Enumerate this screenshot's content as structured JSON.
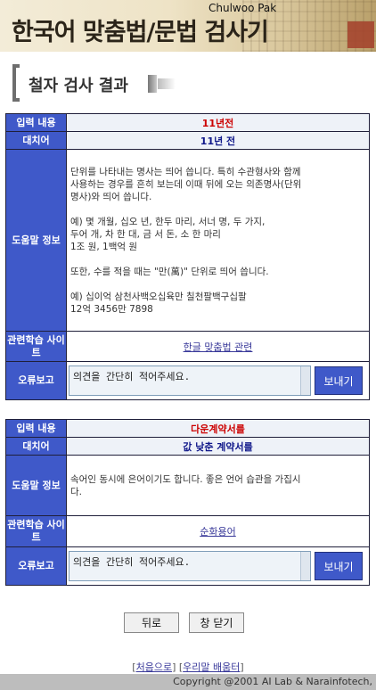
{
  "header": {
    "title": "한국어 맞춤법/문법 검사기",
    "author": "Chulwoo Pak"
  },
  "section_title": "철자 검사 결과",
  "results": [
    {
      "input_label": "입력 내용",
      "input_value": "11년전",
      "suggestion_label": "대치어",
      "suggestion_value": "11년 전",
      "help_label": "도움말 정보",
      "help_text": [
        "단위를 나타내는 명사는 띄어 씁니다. 특히 수관형사와 함께",
        "사용하는 경우를 흔히 보는데 이때 뒤에 오는 의존명사(단위",
        "명사)와 띄어 씁니다.",
        "",
        "예) 몇 개월, 십오 년, 한두 마리, 서너 명, 두 가지,",
        "두어 개, 차 한 대, 금 서 돈, 소 한 마리",
        "1조 원, 1백억 원",
        "",
        "또한, 수를 적을 때는 \"만(萬)\" 단위로 띄어 씁니다.",
        "",
        "예) 십이억 삼천사백오십육만 칠천팔백구십팔",
        "12억 3456만 7898"
      ],
      "related_label": "관련학습 사이트",
      "related_link": "한글 맞춤법 관련",
      "report_label": "오류보고",
      "report_placeholder": "의견을 간단히 적어주세요.",
      "report_button": "보내기"
    },
    {
      "input_label": "입력 내용",
      "input_value": "다운계약서를",
      "suggestion_label": "대치어",
      "suggestion_value": "값 낮춘 계약서를",
      "help_label": "도움말 정보",
      "help_text": [
        "속어인 동시에 은어이기도 합니다. 좋은 언어 습관을 가집시",
        "다."
      ],
      "related_label": "관련학습 사이트",
      "related_link": "순화용어",
      "report_label": "오류보고",
      "report_placeholder": "의견을 간단히 적어주세요.",
      "report_button": "보내기"
    }
  ],
  "buttons": {
    "back": "뒤로",
    "close": "창 닫기"
  },
  "footer": {
    "link_home": "처음으로",
    "link_learn": "우리말 배움터",
    "copyright": "Copyright @2001 AI Lab & Narainfotech,"
  }
}
